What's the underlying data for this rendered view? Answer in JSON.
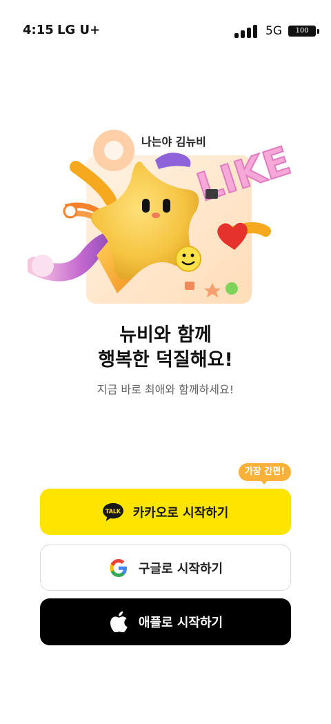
{
  "status_bar": {
    "time": "4:15",
    "carrier": "LG U+",
    "network": "5G",
    "battery": "100"
  },
  "hero": {
    "caption": "나는야 김뉴비",
    "sign_text": "LIKE"
  },
  "headline": {
    "line1": "뉴비와 함께",
    "line2": "행복한 덕질해요!"
  },
  "subline": "지금 바로 최애와 함께하세요!",
  "tooltip": "가장 간편!",
  "buttons": {
    "kakao": {
      "label": "카카오로 시작하기",
      "icon_text": "TALK"
    },
    "google": {
      "label": "구글로 시작하기"
    },
    "apple": {
      "label": "애플로 시작하기"
    }
  },
  "colors": {
    "kakao": "#fee500",
    "tooltip": "#f9b13a",
    "apple": "#000000"
  }
}
